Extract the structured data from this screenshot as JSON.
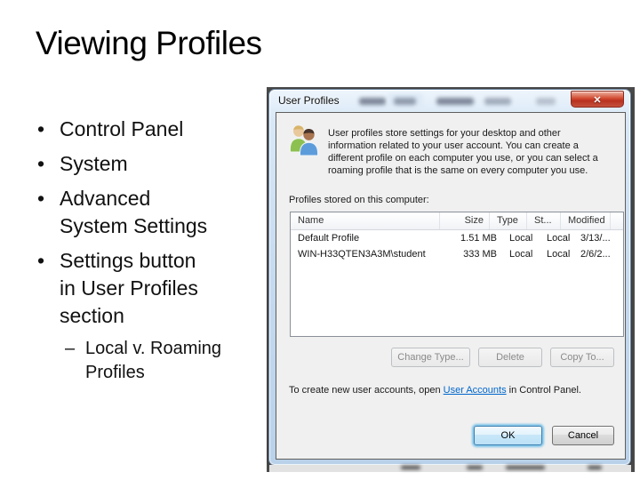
{
  "slide": {
    "title": "Viewing Profiles",
    "bullets": [
      {
        "marker": "•",
        "text": "Control Panel"
      },
      {
        "marker": "•",
        "text": "System"
      },
      {
        "marker": "•",
        "text": "Advanced\nSystem Settings"
      },
      {
        "marker": "•",
        "text": "Settings button\nin User Profiles\nsection"
      },
      {
        "marker": "–",
        "text": "Local v. Roaming\nProfiles"
      }
    ]
  },
  "dialog": {
    "title": "User Profiles",
    "close_glyph": "✕",
    "icon": "two-users-icon",
    "description": "User profiles store settings for your desktop and other\ninformation related to your user account. You can create a\ndifferent profile on each computer you use, or you can select a\nroaming profile that is the same on every computer you use.",
    "profiles_label": "Profiles stored on this computer:",
    "table": {
      "columns": [
        "Name",
        "Size",
        "Type",
        "St...",
        "Modified"
      ],
      "rows": [
        {
          "name": "Default Profile",
          "size": "1.51 MB",
          "type": "Local",
          "status": "Local",
          "modified": "3/13/..."
        },
        {
          "name": "WIN-H33QTEN3A3M\\student",
          "size": "333 MB",
          "type": "Local",
          "status": "Local",
          "modified": "2/6/2..."
        }
      ]
    },
    "buttons": {
      "change_type": "Change Type...",
      "delete": "Delete",
      "copy_to": "Copy To...",
      "ok": "OK",
      "cancel": "Cancel"
    },
    "footer": {
      "before_link": "To create new user accounts, open ",
      "link": "User Accounts",
      "after_link": " in Control Panel."
    },
    "colors": {
      "link": "#0066cc",
      "close_button_red": "#d24b31",
      "aero_frame": "#c3d9ee",
      "client_face": "#f0f0f0"
    }
  }
}
